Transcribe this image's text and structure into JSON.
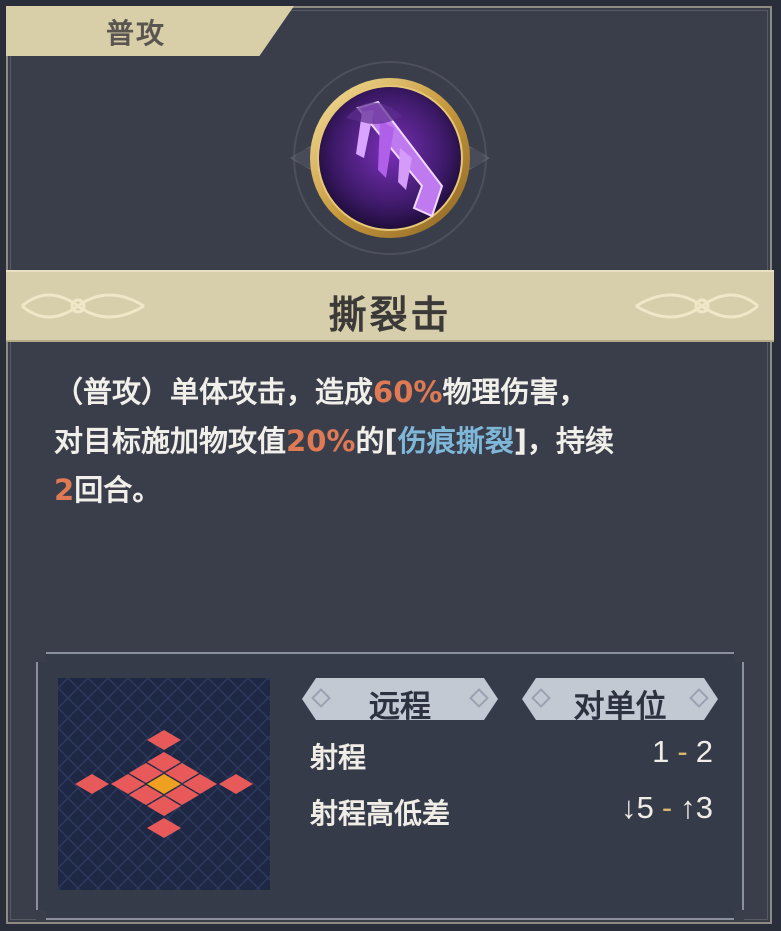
{
  "tab": {
    "label": "普攻"
  },
  "skill": {
    "icon": "purple-claw-icon",
    "name": "撕裂击",
    "description": {
      "line1_a": "（普攻）单体攻击，造成",
      "line1_num": "60%",
      "line1_b": "物理伤害，",
      "line2_a": "对目标施加物攻值",
      "line2_num": "20%",
      "line2_b": "的[",
      "line2_buff": "伤痕撕裂",
      "line2_c": "]，持续",
      "line3_num": "2",
      "line3_b": "回合。"
    }
  },
  "info": {
    "attack_type": "远程",
    "target_type": "对单位",
    "range_label": "射程",
    "range_min": "1",
    "range_sep": "-",
    "range_max": "2",
    "height_label": "射程高低差",
    "height_down": "5",
    "height_sep": "-",
    "height_up": "3"
  },
  "colors": {
    "accent_number": "#e07a55",
    "buff_text": "#7fb7d8",
    "grid_tile": "#e85a5a",
    "grid_center": "#f0a020"
  }
}
